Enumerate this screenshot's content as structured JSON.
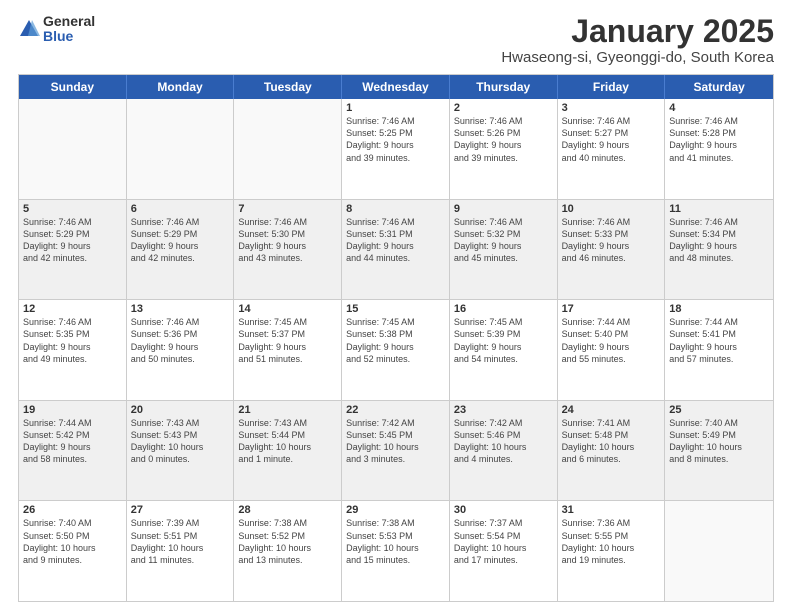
{
  "logo": {
    "general": "General",
    "blue": "Blue"
  },
  "title": "January 2025",
  "subtitle": "Hwaseong-si, Gyeonggi-do, South Korea",
  "header_days": [
    "Sunday",
    "Monday",
    "Tuesday",
    "Wednesday",
    "Thursday",
    "Friday",
    "Saturday"
  ],
  "weeks": [
    [
      {
        "day": "",
        "info": ""
      },
      {
        "day": "",
        "info": ""
      },
      {
        "day": "",
        "info": ""
      },
      {
        "day": "1",
        "info": "Sunrise: 7:46 AM\nSunset: 5:25 PM\nDaylight: 9 hours\nand 39 minutes."
      },
      {
        "day": "2",
        "info": "Sunrise: 7:46 AM\nSunset: 5:26 PM\nDaylight: 9 hours\nand 39 minutes."
      },
      {
        "day": "3",
        "info": "Sunrise: 7:46 AM\nSunset: 5:27 PM\nDaylight: 9 hours\nand 40 minutes."
      },
      {
        "day": "4",
        "info": "Sunrise: 7:46 AM\nSunset: 5:28 PM\nDaylight: 9 hours\nand 41 minutes."
      }
    ],
    [
      {
        "day": "5",
        "info": "Sunrise: 7:46 AM\nSunset: 5:29 PM\nDaylight: 9 hours\nand 42 minutes."
      },
      {
        "day": "6",
        "info": "Sunrise: 7:46 AM\nSunset: 5:29 PM\nDaylight: 9 hours\nand 42 minutes."
      },
      {
        "day": "7",
        "info": "Sunrise: 7:46 AM\nSunset: 5:30 PM\nDaylight: 9 hours\nand 43 minutes."
      },
      {
        "day": "8",
        "info": "Sunrise: 7:46 AM\nSunset: 5:31 PM\nDaylight: 9 hours\nand 44 minutes."
      },
      {
        "day": "9",
        "info": "Sunrise: 7:46 AM\nSunset: 5:32 PM\nDaylight: 9 hours\nand 45 minutes."
      },
      {
        "day": "10",
        "info": "Sunrise: 7:46 AM\nSunset: 5:33 PM\nDaylight: 9 hours\nand 46 minutes."
      },
      {
        "day": "11",
        "info": "Sunrise: 7:46 AM\nSunset: 5:34 PM\nDaylight: 9 hours\nand 48 minutes."
      }
    ],
    [
      {
        "day": "12",
        "info": "Sunrise: 7:46 AM\nSunset: 5:35 PM\nDaylight: 9 hours\nand 49 minutes."
      },
      {
        "day": "13",
        "info": "Sunrise: 7:46 AM\nSunset: 5:36 PM\nDaylight: 9 hours\nand 50 minutes."
      },
      {
        "day": "14",
        "info": "Sunrise: 7:45 AM\nSunset: 5:37 PM\nDaylight: 9 hours\nand 51 minutes."
      },
      {
        "day": "15",
        "info": "Sunrise: 7:45 AM\nSunset: 5:38 PM\nDaylight: 9 hours\nand 52 minutes."
      },
      {
        "day": "16",
        "info": "Sunrise: 7:45 AM\nSunset: 5:39 PM\nDaylight: 9 hours\nand 54 minutes."
      },
      {
        "day": "17",
        "info": "Sunrise: 7:44 AM\nSunset: 5:40 PM\nDaylight: 9 hours\nand 55 minutes."
      },
      {
        "day": "18",
        "info": "Sunrise: 7:44 AM\nSunset: 5:41 PM\nDaylight: 9 hours\nand 57 minutes."
      }
    ],
    [
      {
        "day": "19",
        "info": "Sunrise: 7:44 AM\nSunset: 5:42 PM\nDaylight: 9 hours\nand 58 minutes."
      },
      {
        "day": "20",
        "info": "Sunrise: 7:43 AM\nSunset: 5:43 PM\nDaylight: 10 hours\nand 0 minutes."
      },
      {
        "day": "21",
        "info": "Sunrise: 7:43 AM\nSunset: 5:44 PM\nDaylight: 10 hours\nand 1 minute."
      },
      {
        "day": "22",
        "info": "Sunrise: 7:42 AM\nSunset: 5:45 PM\nDaylight: 10 hours\nand 3 minutes."
      },
      {
        "day": "23",
        "info": "Sunrise: 7:42 AM\nSunset: 5:46 PM\nDaylight: 10 hours\nand 4 minutes."
      },
      {
        "day": "24",
        "info": "Sunrise: 7:41 AM\nSunset: 5:48 PM\nDaylight: 10 hours\nand 6 minutes."
      },
      {
        "day": "25",
        "info": "Sunrise: 7:40 AM\nSunset: 5:49 PM\nDaylight: 10 hours\nand 8 minutes."
      }
    ],
    [
      {
        "day": "26",
        "info": "Sunrise: 7:40 AM\nSunset: 5:50 PM\nDaylight: 10 hours\nand 9 minutes."
      },
      {
        "day": "27",
        "info": "Sunrise: 7:39 AM\nSunset: 5:51 PM\nDaylight: 10 hours\nand 11 minutes."
      },
      {
        "day": "28",
        "info": "Sunrise: 7:38 AM\nSunset: 5:52 PM\nDaylight: 10 hours\nand 13 minutes."
      },
      {
        "day": "29",
        "info": "Sunrise: 7:38 AM\nSunset: 5:53 PM\nDaylight: 10 hours\nand 15 minutes."
      },
      {
        "day": "30",
        "info": "Sunrise: 7:37 AM\nSunset: 5:54 PM\nDaylight: 10 hours\nand 17 minutes."
      },
      {
        "day": "31",
        "info": "Sunrise: 7:36 AM\nSunset: 5:55 PM\nDaylight: 10 hours\nand 19 minutes."
      },
      {
        "day": "",
        "info": ""
      }
    ]
  ]
}
